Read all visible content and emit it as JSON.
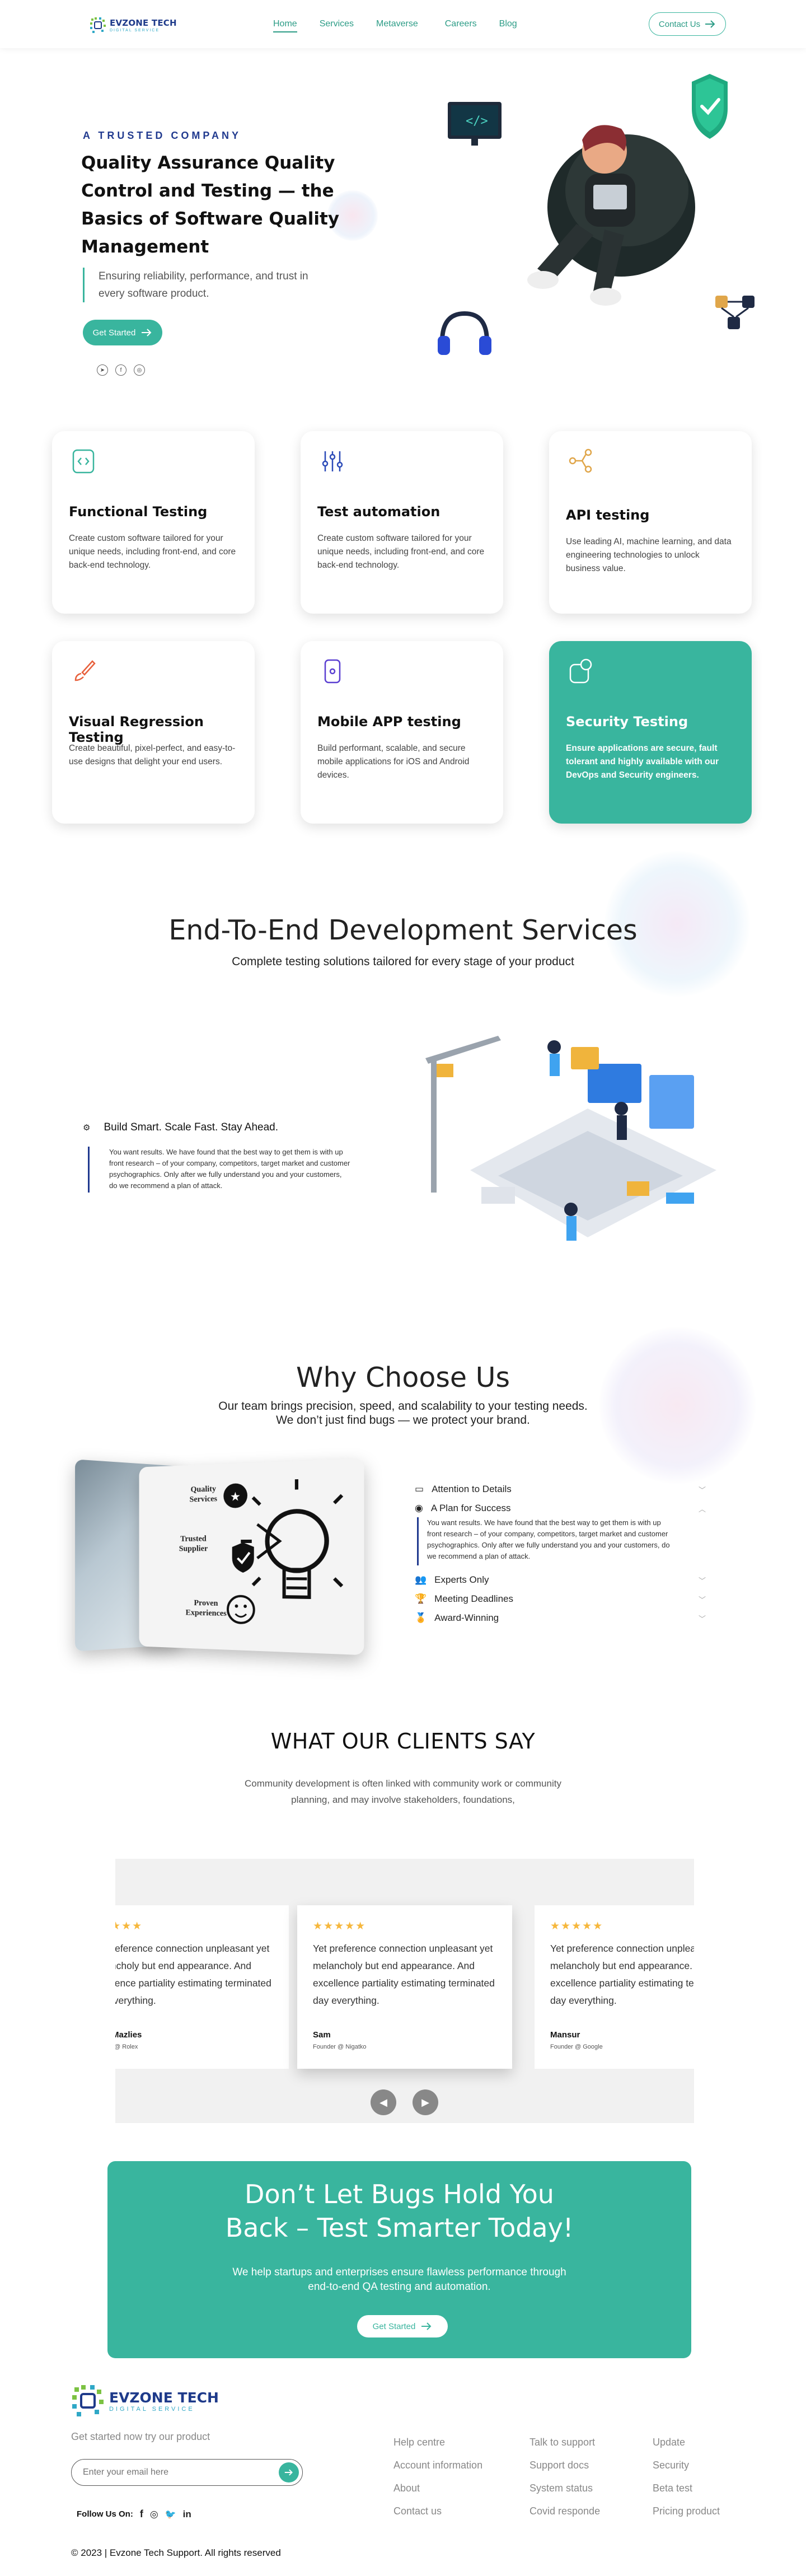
{
  "header": {
    "logo_main": "EVZONE TECH",
    "logo_sub": "DIGITAL SERVICE",
    "nav": [
      "Home",
      "Services",
      "Metaverse",
      "Careers",
      "Blog"
    ],
    "contact_label": "Contact Us"
  },
  "hero": {
    "eyebrow": "A TRUSTED COMPANY",
    "title": "Quality Assurance Quality Control and Testing — the Basics of Software Quality Management",
    "subtitle": "Ensuring reliability, performance, and trust in every software product.",
    "cta_label": "Get Started"
  },
  "services": [
    {
      "title": "Functional Testing",
      "desc": "Create custom software tailored for your unique needs, including front-end, and core back-end technology.",
      "icon": "code-file-icon"
    },
    {
      "title": "Test automation",
      "desc": "Create custom software tailored for your unique needs, including front-end, and core back-end technology.",
      "icon": "sliders-icon"
    },
    {
      "title": "API testing",
      "desc": "Use leading AI, machine learning, and data engineering technologies to unlock business value.",
      "icon": "network-icon"
    },
    {
      "title": "Visual Regression Testing",
      "desc": "Create beautiful, pixel-perfect, and easy-to-use designs that delight your end users.",
      "icon": "brush-icon"
    },
    {
      "title": "Mobile APP testing",
      "desc": "Build performant, scalable, and secure mobile applications for iOS and Android devices.",
      "icon": "mobile-icon"
    },
    {
      "title": "Security Testing",
      "desc": "Ensure applications are secure, fault tolerant and highly available with our DevOps and Security engineers.",
      "icon": "shield-check-icon"
    }
  ],
  "e2e": {
    "title": "End-To-End Development Services",
    "subtitle": "Complete testing solutions tailored for every stage of your product",
    "heading": "Build Smart. Scale Fast. Stay Ahead.",
    "body": "You want results. We have found that the best way to get them is with up front research – of your company, competitors, target market and customer psychographics. Only after we fully understand you and your customers, do we recommend a plan of attack."
  },
  "why": {
    "title": "Why Choose Us",
    "subtitle_line1": "Our team brings precision, speed, and scalability to your testing needs.",
    "subtitle_line2": "We don’t just find bugs — we protect your brand.",
    "graphic_labels": [
      "Quality Services",
      "Trusted Supplier",
      "Proven Experiences"
    ],
    "items": [
      "Attention to Details",
      "A Plan for Success",
      "Experts Only",
      "Meeting Deadlines",
      "Award-Winning"
    ],
    "open_body": "You want results. We have found that the best way to get them is with up front research – of your company, competitors, target market and customer psychographics. Only after we fully understand you and your customers, do we recommend a plan of attack."
  },
  "testimonials": {
    "title": "WHAT OUR CLIENTS SAY",
    "subtitle_line1": "Community development is often linked with community work or community",
    "subtitle_line2": "planning, and may involve stakeholders, foundations,",
    "stars": "★★★★★",
    "items": [
      {
        "text": "Yet preference connection unpleasant yet melancholy but end appearance. And excellence partiality estimating terminated day everything.",
        "name": "Saba Mazlies",
        "role": "Founder @ Rolex"
      },
      {
        "text": "Yet preference connection unpleasant yet melancholy but end appearance. And excellence partiality estimating terminated day everything.",
        "name": "Sam",
        "role": "Founder @ Nigatko"
      },
      {
        "text": "Yet preference connection unpleasant yet melancholy but end appearance. And excellence partiality estimating terminated day everything.",
        "name": "Mansur",
        "role": "Founder @ Google"
      }
    ]
  },
  "cta": {
    "title_line1": "Don’t Let Bugs Hold You",
    "title_line2": "Back – Test Smarter Today!",
    "body_line1": "We help startups and enterprises ensure flawless performance through",
    "body_line2": "end-to-end QA testing and automation.",
    "button": "Get Started"
  },
  "footer": {
    "logo_main": "EVZONE TECH",
    "logo_sub": "DIGITAL SERVICE",
    "tagline": "Get started now try our product",
    "email_placeholder": "Enter your email here",
    "follow": "Follow Us On:",
    "col1": [
      "Help centre",
      "Account information",
      "About",
      "Contact us"
    ],
    "col2": [
      "Talk to support",
      "Support docs",
      "System status",
      "Covid responde"
    ],
    "col3": [
      "Update",
      "Security",
      "Beta test",
      "Pricing product"
    ],
    "copyright": "© 2023 | Evzone Tech Support. All rights reserved"
  },
  "colors": {
    "accent": "#39b59e",
    "brand_navy": "#213a8f",
    "stars": "#f6b73c"
  }
}
